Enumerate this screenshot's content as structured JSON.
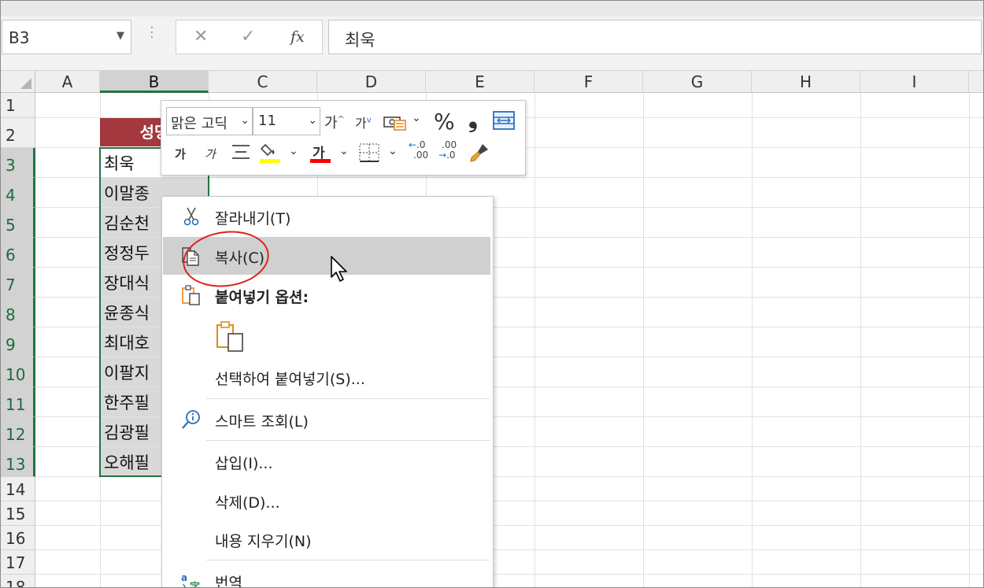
{
  "formula_bar": {
    "name_box": "B3",
    "cancel_symbol": "✕",
    "enter_symbol": "✓",
    "fx_symbol": "fx",
    "formula_value": "최욱"
  },
  "columns": [
    "A",
    "B",
    "C",
    "D",
    "E",
    "F",
    "G",
    "H",
    "I"
  ],
  "rows": [
    "1",
    "2",
    "3",
    "4",
    "5",
    "6",
    "7",
    "8",
    "9",
    "10",
    "11",
    "12",
    "13",
    "14",
    "15",
    "16",
    "17",
    "18"
  ],
  "sheet": {
    "header_cell": "성명",
    "names": [
      "최욱",
      "이말종",
      "김순천",
      "정정두",
      "장대식",
      "윤종식",
      "최대호",
      "이팔지",
      "한주필",
      "김광필",
      "오해필"
    ]
  },
  "mini_toolbar": {
    "font_name": "맑은 고딕",
    "font_size": "11",
    "grow_font": "가",
    "shrink_font": "가",
    "percent": "%",
    "comma": "❟",
    "bold": "가",
    "italic": "가",
    "font_color_glyph": "가",
    "inc_decimal_top": ".0",
    "inc_decimal_bottom": ".00",
    "dec_decimal_top": ".00",
    "dec_decimal_bottom": ".0",
    "fill_color": "#ffff00",
    "font_color": "#ff0000"
  },
  "context_menu": {
    "cut": "잘라내기(T)",
    "copy": "복사(C)",
    "paste_options": "붙여넣기 옵션:",
    "paste_special": "선택하여 붙여넣기(S)...",
    "smart_lookup": "스마트 조회(L)",
    "insert": "삽입(I)...",
    "delete": "삭제(D)...",
    "clear_contents": "내용 지우기(N)",
    "translate": "번역"
  },
  "colors": {
    "accent_green": "#217346",
    "header_fill": "#a3383f",
    "annotation_red": "#e02020"
  }
}
